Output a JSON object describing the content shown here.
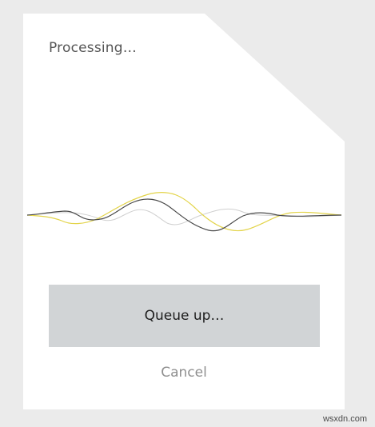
{
  "dialog": {
    "status_text": "Processing…",
    "primary_button_label": "Queue up…",
    "cancel_label": "Cancel"
  },
  "waveform": {
    "colors": {
      "dark": "#4a4a4a",
      "yellow": "#e3d44a",
      "light": "#d0d0d0"
    }
  },
  "watermark": "wsxdn.com"
}
